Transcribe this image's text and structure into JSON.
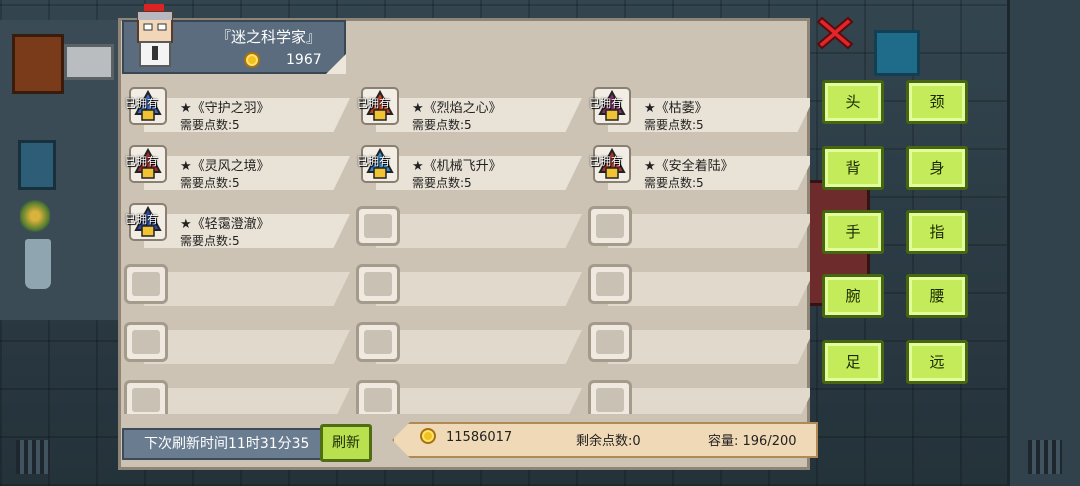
{
  "header": {
    "title": "『迷之科学家』",
    "gold": "1967",
    "avatar_icon": "scientist-avatar-icon"
  },
  "items": [
    {
      "owned": "已拥有",
      "name": "★《守护之羽》",
      "cost": "需要点数:5",
      "icon": "feather-icon",
      "color": "#3d6fcf"
    },
    {
      "owned": "已拥有",
      "name": "★《烈焰之心》",
      "cost": "需要点数:5",
      "icon": "flame-heart-icon",
      "color": "#d33b1f"
    },
    {
      "owned": "已拥有",
      "name": "★《枯萎》",
      "cost": "需要点数:5",
      "icon": "wither-icon",
      "color": "#8a2d6b"
    },
    {
      "owned": "已拥有",
      "name": "★《灵风之境》",
      "cost": "需要点数:5",
      "icon": "wind-realm-icon",
      "color": "#b02a2a"
    },
    {
      "owned": "已拥有",
      "name": "★《机械飞升》",
      "cost": "需要点数:5",
      "icon": "mech-ascend-icon",
      "color": "#2f8fd9"
    },
    {
      "owned": "已拥有",
      "name": "★《安全着陆》",
      "cost": "需要点数:5",
      "icon": "safe-landing-icon",
      "color": "#b8332a"
    },
    {
      "owned": "已拥有",
      "name": "★《轻霭澄澈》",
      "cost": "需要点数:5",
      "icon": "clear-mist-icon",
      "color": "#2a4bb0"
    }
  ],
  "empty_slots": 11,
  "footer": {
    "refresh_time": "下次刷新时间11时31分35",
    "refresh_button": "刷新",
    "gold": "11586017",
    "points": "剩余点数:0",
    "capacity": "容量:  196/200"
  },
  "body_parts": [
    "头",
    "颈",
    "背",
    "身",
    "手",
    "指",
    "腕",
    "腰",
    "足",
    "远"
  ],
  "colors": {
    "panel": "#cdc3b4",
    "header": "#5a6c7e",
    "button_green": "#c4ec5a",
    "close_red": "#e0262b"
  }
}
